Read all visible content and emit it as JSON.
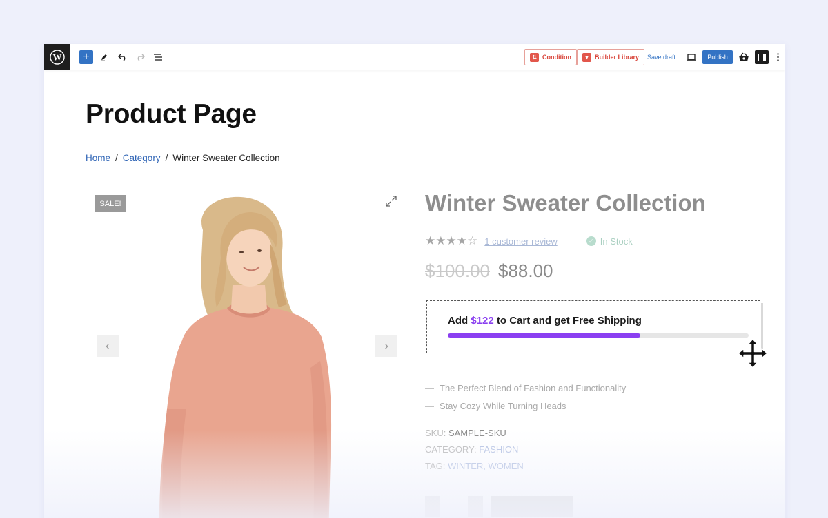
{
  "toolbar": {
    "condition_label": "Condition",
    "builder_library_label": "Builder Library",
    "save_draft_label": "Save draft",
    "publish_label": "Publish"
  },
  "page": {
    "title": "Product Page",
    "breadcrumb": [
      "Home",
      "Category",
      "Winter Sweater Collection"
    ],
    "breadcrumb_separator": "/"
  },
  "gallery": {
    "sale_badge": "SALE!",
    "prev_arrow": "‹",
    "next_arrow": "›"
  },
  "product": {
    "title": "Winter Sweater Collection",
    "rating": 4,
    "rating_max": 5,
    "review_link": "1 customer review",
    "stock_status": "In Stock",
    "old_price": "$100.00",
    "new_price": "$88.00",
    "features": [
      "The Perfect Blend of Fashion and Functionality",
      "Stay Cozy While Turning Heads"
    ],
    "sku_label": "SKU:",
    "sku_value": "SAMPLE-SKU",
    "category_label": "CATEGORY:",
    "category_value": "FASHION",
    "tag_label": "TAG:",
    "tag_values": "WINTER, WOMEN"
  },
  "free_shipping": {
    "text_before": "Add ",
    "amount": "$122",
    "text_after": " to Cart and get Free Shipping",
    "progress_fraction": 0.64
  },
  "colors": {
    "accent_blue": "#3373c4",
    "progress_purple": "#8b3ff1",
    "library_red": "#d9443a"
  },
  "icons": {
    "wordpress": "wordpress-logo-icon",
    "add": "plus-icon",
    "edit": "pencil-icon",
    "undo": "undo-icon",
    "redo": "redo-icon",
    "list_view": "list-view-icon",
    "preview": "desktop-preview-icon",
    "cart": "shopping-basket-icon",
    "settings": "sidebar-settings-icon",
    "more": "kebab-menu-icon",
    "zoom": "expand-icon",
    "move": "move-cursor-icon"
  }
}
